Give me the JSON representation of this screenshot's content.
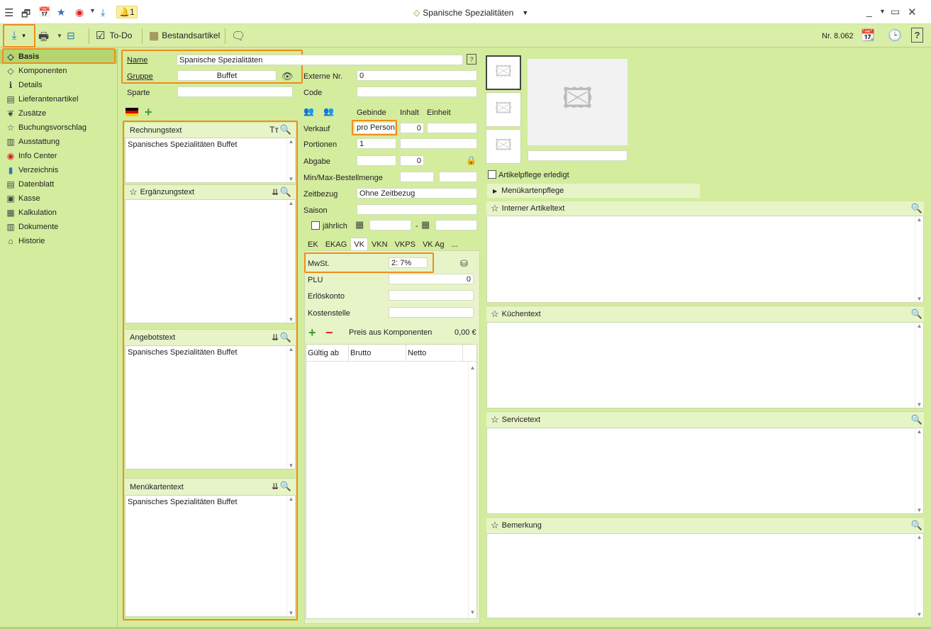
{
  "window": {
    "title": "Spanische Spezialitäten",
    "notification_count": "1"
  },
  "toolbar": {
    "todo_label": "To-Do",
    "bestand_label": "Bestandsartikel",
    "number": "Nr. 8.062"
  },
  "sidebar": {
    "items": [
      {
        "label": "Basis",
        "icon": "tag-icon"
      },
      {
        "label": "Komponenten",
        "icon": "tag-outline-icon"
      },
      {
        "label": "Details",
        "icon": "info-icon"
      },
      {
        "label": "Lieferantenartikel",
        "icon": "supplier-icon"
      },
      {
        "label": "Zusätze",
        "icon": "leaf-icon"
      },
      {
        "label": "Buchungsvorschlag",
        "icon": "star-icon"
      },
      {
        "label": "Ausstattung",
        "icon": "barcode-icon"
      },
      {
        "label": "Info Center",
        "icon": "compass-icon"
      },
      {
        "label": "Verzeichnis",
        "icon": "book-icon"
      },
      {
        "label": "Datenblatt",
        "icon": "sheet-icon"
      },
      {
        "label": "Kasse",
        "icon": "register-icon"
      },
      {
        "label": "Kalkulation",
        "icon": "grid-icon"
      },
      {
        "label": "Dokumente",
        "icon": "documents-icon"
      },
      {
        "label": "Historie",
        "icon": "history-icon"
      }
    ]
  },
  "form": {
    "name_label": "Name",
    "name_value": "Spanische Spezialitäten",
    "gruppe_label": "Gruppe",
    "gruppe_value": "Buffet",
    "sparte_label": "Sparte",
    "sparte_value": "",
    "externe_label": "Externe Nr.",
    "externe_value": "0",
    "code_label": "Code",
    "code_value": ""
  },
  "texts": {
    "rechnung_label": "Rechnungstext",
    "rechnung_value": "Spanisches Spezialitäten Buffet",
    "ergaenzung_label": "Ergänzungstext",
    "ergaenzung_value": "",
    "angebot_label": "Angebotstext",
    "angebot_value": "Spanisches Spezialitäten Buffet",
    "menu_label": "Menükartentext",
    "menu_value": "Spanisches Spezialitäten Buffet"
  },
  "pricing": {
    "gebinde_label": "Gebinde",
    "inhalt_label": "Inhalt",
    "einheit_label": "Einheit",
    "verkauf_label": "Verkauf",
    "verkauf_gebinde": "pro Person",
    "verkauf_inhalt": "0",
    "portionen_label": "Portionen",
    "portionen_value": "1",
    "abgabe_label": "Abgabe",
    "abgabe_inhalt": "0",
    "minmax_label": "Min/Max-Bestellmenge",
    "zeitbezug_label": "Zeitbezug",
    "zeitbezug_value": "Ohne Zeitbezug",
    "saison_label": "Saison",
    "jaehrlich_label": "jährlich",
    "dash": "-"
  },
  "tabs": [
    "EK",
    "EKAG",
    "VK",
    "VKN",
    "VKPS",
    "VK Ag",
    "..."
  ],
  "vk": {
    "mwst_label": "MwSt.",
    "mwst_value": "2: 7%",
    "plu_label": "PLU",
    "plu_value": "0",
    "erloes_label": "Erlöskonto",
    "kosten_label": "Kostenstelle",
    "preis_label": "Preis aus Komponenten",
    "preis_value": "0,00 €",
    "col_gueltig": "Gültig ab",
    "col_brutto": "Brutto",
    "col_netto": "Netto"
  },
  "right": {
    "artikelpflege_label": "Artikelpflege erledigt",
    "menukartenpflege_label": "Menükartenpflege",
    "intern_label": "Interner Artikeltext",
    "kuechen_label": "Küchentext",
    "service_label": "Servicetext",
    "bemerkung_label": "Bemerkung"
  },
  "colors": {
    "background": "#d4ec9e",
    "highlight": "#f08c1e"
  }
}
